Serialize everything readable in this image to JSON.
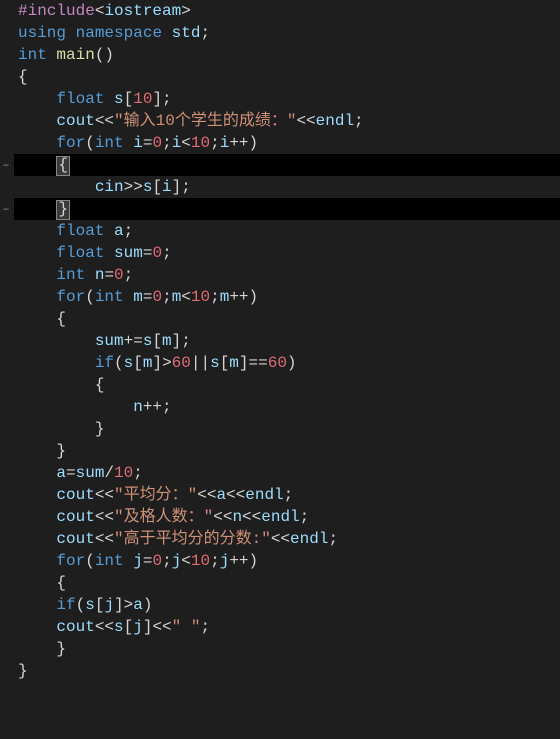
{
  "code": {
    "l1": {
      "include": "#include",
      "lt": "<",
      "hdr": "iostream",
      "gt": ">"
    },
    "l2": {
      "using": "using",
      "ns": "namespace",
      "std": "std",
      "semi": ";"
    },
    "l3": {
      "int": "int",
      "main": "main",
      "paren": "()"
    },
    "l4": {
      "brace": "{"
    },
    "l5": {
      "indent": "    ",
      "float": "float",
      "s": "s",
      "lb": "[",
      "ten": "10",
      "rb": "];"
    },
    "l6": {
      "indent": "    ",
      "cout": "cout",
      "ins1": "<<",
      "str": "\"输入10个学生的成绩：\"",
      "ins2": "<<",
      "endl": "endl",
      "semi": ";"
    },
    "l7": {
      "indent": "    ",
      "for": "for",
      "lp": "(",
      "int": "int",
      "i": "i",
      "eq": "=",
      "z": "0",
      "semi1": ";",
      "i2": "i",
      "lt": "<",
      "ten": "10",
      "semi2": ";",
      "i3": "i",
      "pp": "++",
      ")": ")"
    },
    "l8": {
      "indent": "    ",
      "brace": "{"
    },
    "l9": {
      "indent": "        ",
      "cin": "cin",
      "ext": ">>",
      "s": "s",
      "lb": "[",
      "i": "i",
      "rb": "];"
    },
    "l10": {
      "indent": "    ",
      "brace": "}"
    },
    "l11": {
      "indent": "    ",
      "float": "float",
      "a": "a",
      "semi": ";"
    },
    "l12": {
      "indent": "    ",
      "float": "float",
      "sum": "sum",
      "eq": "=",
      "z": "0",
      "semi": ";"
    },
    "l13": {
      "indent": "    ",
      "int": "int",
      "n": "n",
      "eq": "=",
      "z": "0",
      "semi": ";"
    },
    "l14": {
      "indent": "    ",
      "for": "for",
      "lp": "(",
      "int": "int",
      "m": "m",
      "eq": "=",
      "z": "0",
      "semi1": ";",
      "m2": "m",
      "lt": "<",
      "ten": "10",
      "semi2": ";",
      "m3": "m",
      "pp": "++",
      ")": ")"
    },
    "l15": {
      "indent": "    ",
      "brace": "{"
    },
    "l16": {
      "indent": "        ",
      "sum": "sum",
      "pe": "+=",
      "s": "s",
      "lb": "[",
      "m": "m",
      "rb": "];"
    },
    "l17": {
      "indent": "        ",
      "if": "if",
      "lp": "(",
      "s": "s",
      "lb1": "[",
      "m1": "m",
      "rb1": "]",
      "gt": ">",
      "sixty": "60",
      "or": "||",
      "s2": "s",
      "lb2": "[",
      "m2": "m",
      "rb2": "]",
      "eq": "==",
      "sixty2": "60",
      "rp": ")"
    },
    "l18": {
      "indent": "        ",
      "brace": "{"
    },
    "l19": {
      "indent": "            ",
      "n": "n",
      "pp": "++",
      "semi": ";"
    },
    "l20": {
      "indent": "        ",
      "brace": "}"
    },
    "l21": {
      "indent": "    ",
      "brace": "}"
    },
    "l22": {
      "indent": "    ",
      "a": "a",
      "eq": "=",
      "sum": "sum",
      "div": "/",
      "ten": "10",
      "semi": ";"
    },
    "l23": {
      "indent": "    ",
      "cout": "cout",
      "ins1": "<<",
      "str": "\"平均分：\"",
      "ins2": "<<",
      "a": "a",
      "ins3": "<<",
      "endl": "endl",
      "semi": ";"
    },
    "l24": {
      "indent": "    ",
      "cout": "cout",
      "ins1": "<<",
      "str": "\"及格人数：\"",
      "ins2": "<<",
      "n": "n",
      "ins3": "<<",
      "endl": "endl",
      "semi": ";"
    },
    "l25": {
      "indent": "    ",
      "cout": "cout",
      "ins1": "<<",
      "str": "\"高于平均分的分数:\"",
      "ins2": "<<",
      "endl": "endl",
      "semi": ";"
    },
    "l26": {
      "indent": "    ",
      "for": "for",
      "lp": "(",
      "int": "int",
      "j": "j",
      "eq": "=",
      "z": "0",
      "semi1": ";",
      "j2": "j",
      "lt": "<",
      "ten": "10",
      "semi2": ";",
      "j3": "j",
      "pp": "++",
      ")": ")"
    },
    "l27": {
      "indent": "    ",
      "brace": "{"
    },
    "l28": {
      "indent": "    ",
      "if": "if",
      "lp": "(",
      "s": "s",
      "lb": "[",
      "j": "j",
      "rb": "]",
      "gt": ">",
      "a": "a",
      "rp": ")"
    },
    "l29": {
      "indent": "    ",
      "cout": "cout",
      "ins1": "<<",
      "s": "s",
      "lb": "[",
      "j": "j",
      "rb": "]",
      "ins2": "<<",
      "str": "\" \"",
      "semi": ";"
    },
    "l30": {
      "indent": "    ",
      "brace": "}"
    },
    "l31": {
      "brace": "}"
    }
  }
}
